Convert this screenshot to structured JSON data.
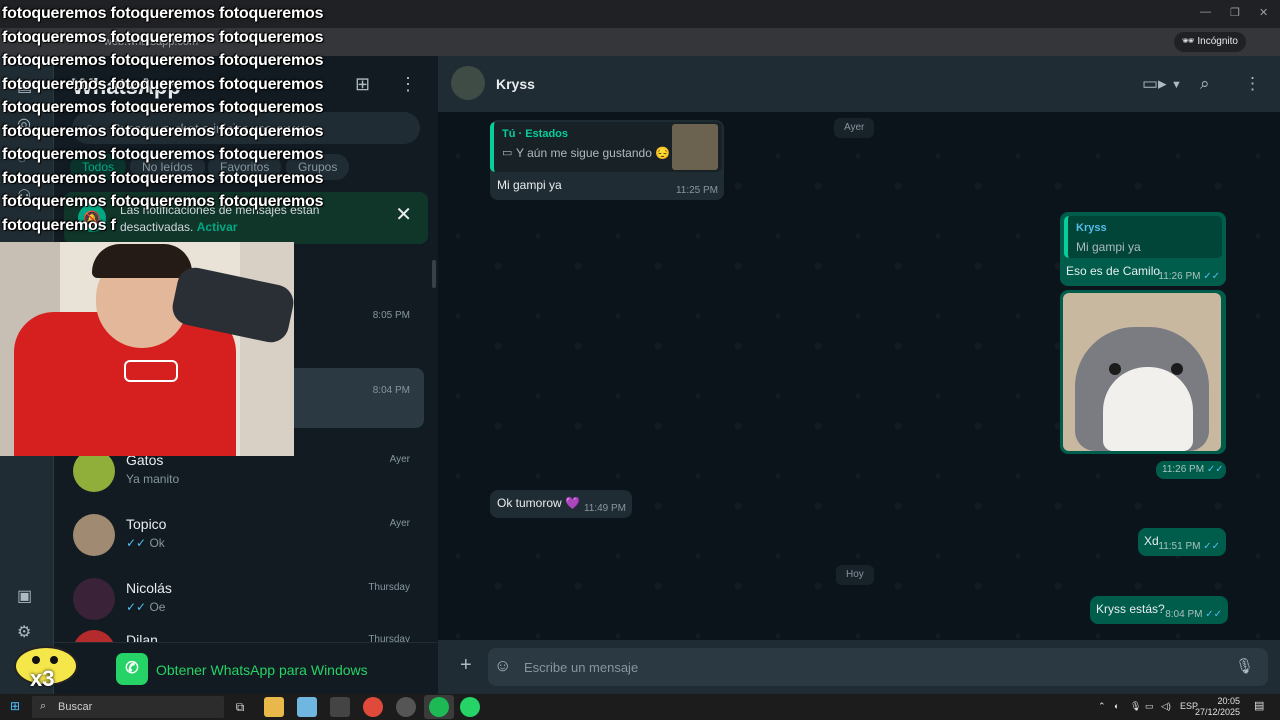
{
  "browser": {
    "url": "web.whatsapp.com",
    "incognito_label": "Incógnito"
  },
  "overlay": {
    "lines": [
      "fotoqueremos fotoqueremos fotoqueremos",
      "fotoqueremos fotoqueremos fotoqueremos",
      "fotoqueremos fotoqueremos fotoqueremos",
      "fotoqueremos fotoqueremos fotoqueremos",
      "fotoqueremos fotoqueremos fotoqueremos",
      "fotoqueremos fotoqueremos fotoqueremos",
      "fotoqueremos fotoqueremos fotoqueremos",
      "fotoqueremos fotoqueremos fotoqueremos",
      "fotoqueremos fotoqueremos fotoqueremos",
      "fotoqueremos f"
    ]
  },
  "chatlist": {
    "title": "WhatsApp",
    "search_placeholder": "Buscar un chat o iniciar uno nuevo",
    "filters": [
      "Todos",
      "No leídos",
      "Favoritos",
      "Grupos"
    ],
    "notification": {
      "text": "Las notificaciones de mensajes están desactivadas.",
      "action": "Activar"
    },
    "rows": [
      {
        "name": "",
        "message": "",
        "time": "8:05 PM"
      },
      {
        "name": "",
        "message": "",
        "time": "8:04 PM"
      },
      {
        "name": "Gatos",
        "message": "Ya manito",
        "time": "Ayer"
      },
      {
        "name": "Topico",
        "message": "Ok",
        "time": "Ayer"
      },
      {
        "name": "Nicolás",
        "message": "Oe",
        "time": "Thursday"
      },
      {
        "name": "Dilan",
        "message": "",
        "time": "Thursday"
      }
    ],
    "get_app": "Obtener WhatsApp para Windows"
  },
  "chat": {
    "name": "Kryss",
    "day_labels": [
      "Ayer",
      "Hoy"
    ],
    "messages": {
      "m1_quote_name": "Tú · Estados",
      "m1_quote_text": "Y aún me sigue gustando 😔",
      "m1_text": "Mi gampi ya",
      "m1_time": "11:25 PM",
      "m2_quote_name": "Kryss",
      "m2_quote_text": "Mi gampi ya",
      "m2_text": "Eso es de Camilo",
      "m2_time": "11:26 PM",
      "m3_time": "11:26 PM",
      "m4_text": "Ok tumorow 💜",
      "m4_time": "11:49 PM",
      "m5_text": "Xd",
      "m5_time": "11:51 PM",
      "m6_text": "Kryss estás?",
      "m6_time": "8:04 PM"
    },
    "composer_placeholder": "Escribe un mensaje"
  },
  "taskbar": {
    "search_placeholder": "Buscar",
    "lang": "ESP",
    "time": "20:05",
    "date": "27/12/2025"
  },
  "colors": {
    "accent": "#00a884",
    "outgoing_bubble": "#005c4b",
    "incoming_bubble": "#202c33",
    "tick_read": "#53bdeb"
  }
}
